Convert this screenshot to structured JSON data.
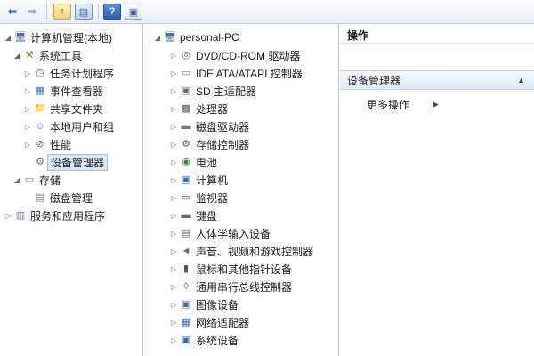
{
  "toolbar": {
    "back_icon": "arrow-left-icon",
    "forward_icon": "arrow-right-icon",
    "up_icon": "folder-up-icon",
    "console_icon": "console-tree-icon",
    "help_icon": "help-icon",
    "help_glyph": "?",
    "properties_icon": "properties-icon"
  },
  "left_tree": {
    "root": "计算机管理(本地)",
    "system_tools": "系统工具",
    "task_scheduler": "任务计划程序",
    "event_viewer": "事件查看器",
    "shared_folders": "共享文件夹",
    "local_users": "本地用户和组",
    "performance": "性能",
    "device_manager": "设备管理器",
    "storage": "存储",
    "disk_management": "磁盘管理",
    "services_apps": "服务和应用程序"
  },
  "mid_tree": {
    "computer_name": "personal-PC",
    "items": [
      "DVD/CD-ROM 驱动器",
      "IDE ATA/ATAPI 控制器",
      "SD 主适配器",
      "处理器",
      "磁盘驱动器",
      "存储控制器",
      "电池",
      "计算机",
      "监视器",
      "键盘",
      "人体学输入设备",
      "声音、视频和游戏控制器",
      "鼠标和其他指针设备",
      "通用串行总线控制器",
      "图像设备",
      "网络适配器",
      "系统设备"
    ]
  },
  "actions": {
    "header": "操作",
    "section": "设备管理器",
    "more": "更多操作"
  }
}
